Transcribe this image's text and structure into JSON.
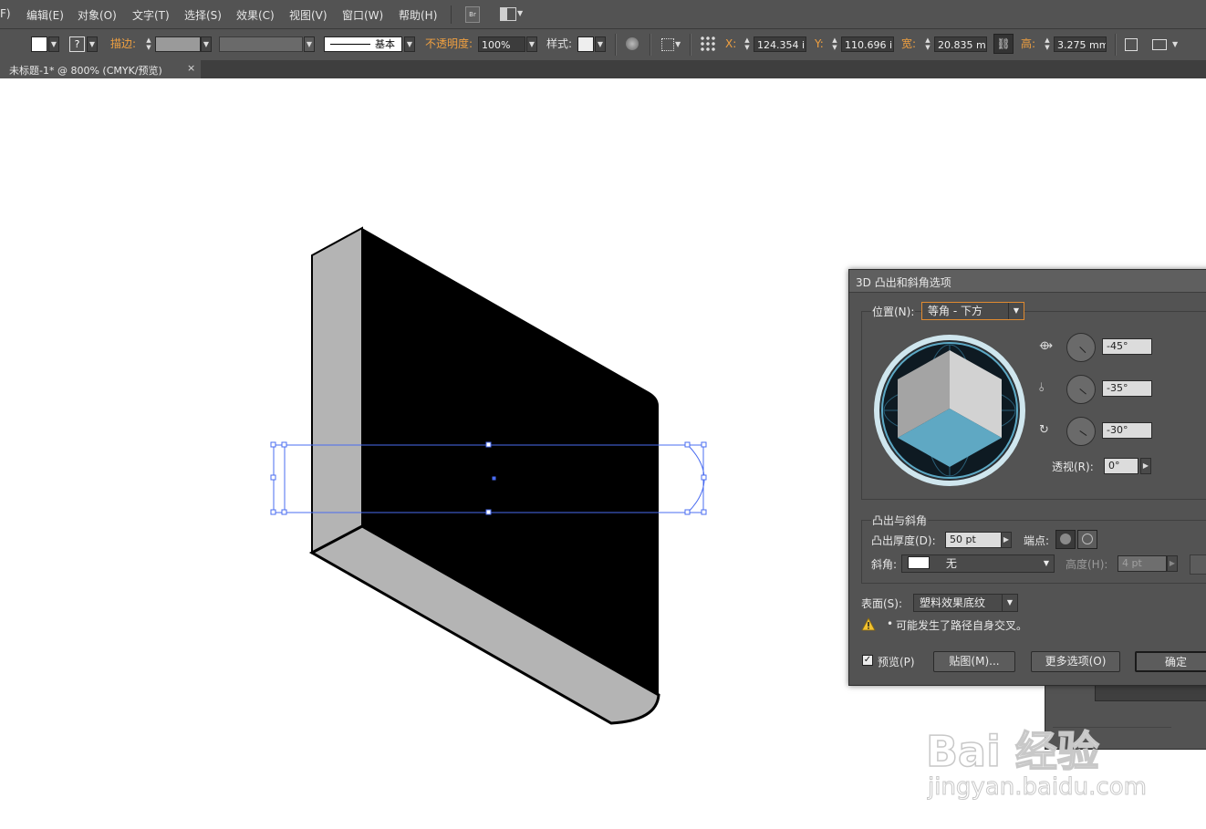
{
  "menu": {
    "items": [
      "F)",
      "编辑(E)",
      "对象(O)",
      "文字(T)",
      "选择(S)",
      "效果(C)",
      "视图(V)",
      "窗口(W)",
      "帮助(H)"
    ],
    "bridge_label": "Br"
  },
  "control_bar": {
    "stroke_label": "描边:",
    "fill_unknown": "?",
    "stroke_profile_label": "基本",
    "opacity_label": "不透明度:",
    "opacity_value": "100%",
    "style_label": "样式:",
    "x_label": "X:",
    "x_value": "124.354 i",
    "y_label": "Y:",
    "y_value": "110.696 i",
    "w_label": "宽:",
    "w_value": "20.835 mi",
    "h_label": "高:",
    "h_value": "3.275 mm"
  },
  "document_tab": {
    "title": "未标题-1* @ 800% (CMYK/预览)",
    "close": "×"
  },
  "dialog": {
    "title": "3D 凸出和斜角选项",
    "position_label": "位置(N):",
    "position_value": "等角 - 下方",
    "rot_x": "-45°",
    "rot_y": "-35°",
    "rot_z": "-30°",
    "perspective_label": "透视(R):",
    "perspective_value": "0°",
    "extrude_section": "凸出与斜角",
    "depth_label": "凸出厚度(D):",
    "depth_value": "50 pt",
    "cap_label": "端点:",
    "bevel_label": "斜角:",
    "bevel_value": "无",
    "height_label": "高度(H):",
    "height_value": "4 pt",
    "surface_label": "表面(S):",
    "surface_value": "塑料效果底纹",
    "warning": "可能发生了路径自身交叉。",
    "preview_label": "预览(P)",
    "preview_checked": true,
    "map_button": "贴图(M)...",
    "more_button": "更多选项(O)",
    "ok_button": "确定"
  },
  "watermark": {
    "brand": "Bai 经验",
    "url": "jingyan.baidu.com"
  },
  "colors": {
    "ui_bg": "#535353",
    "accent_orange": "#f0a040",
    "selection_blue": "#4a6cf0",
    "cube_top": "#5fa8c3"
  }
}
